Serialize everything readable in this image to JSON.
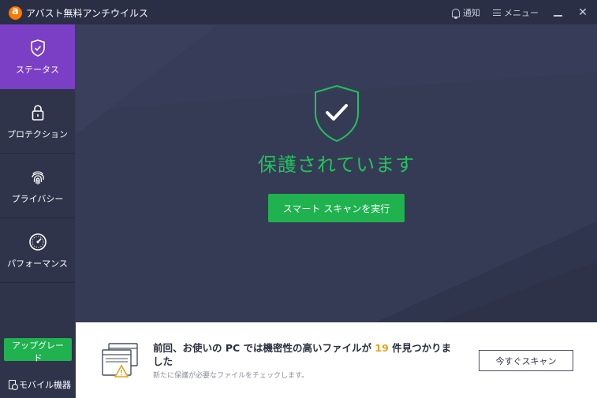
{
  "titlebar": {
    "app_title": "アバスト無料アンチウイルス",
    "notifications_label": "通知",
    "menu_label": "メニュー",
    "minimize_icon": "minimize-icon",
    "close_label": "✕"
  },
  "sidebar": {
    "items": [
      {
        "label": "ステータス",
        "icon": "shield-check-icon",
        "active": true
      },
      {
        "label": "プロテクション",
        "icon": "lock-icon",
        "active": false
      },
      {
        "label": "プライバシー",
        "icon": "fingerprint-icon",
        "active": false
      },
      {
        "label": "パフォーマンス",
        "icon": "speedometer-icon",
        "active": false
      }
    ],
    "upgrade_label": "アップグレード",
    "mobile_label": "モバイル機器"
  },
  "main": {
    "status_text": "保護されています",
    "scan_button_label": "スマート スキャンを実行"
  },
  "alert": {
    "title_before": "前回、お使いの PC では機密性の高いファイルが",
    "count": "19",
    "title_after": "件見つかりました",
    "subtitle": "新たに保護が必要なファイルをチェックします。",
    "button_label": "今すぐスキャン"
  },
  "colors": {
    "accent_green": "#1fb24f",
    "status_green": "#21c25d",
    "active_purple": "#7b3fc6",
    "warning_orange": "#e8a317",
    "logo_orange": "#ff7800"
  }
}
